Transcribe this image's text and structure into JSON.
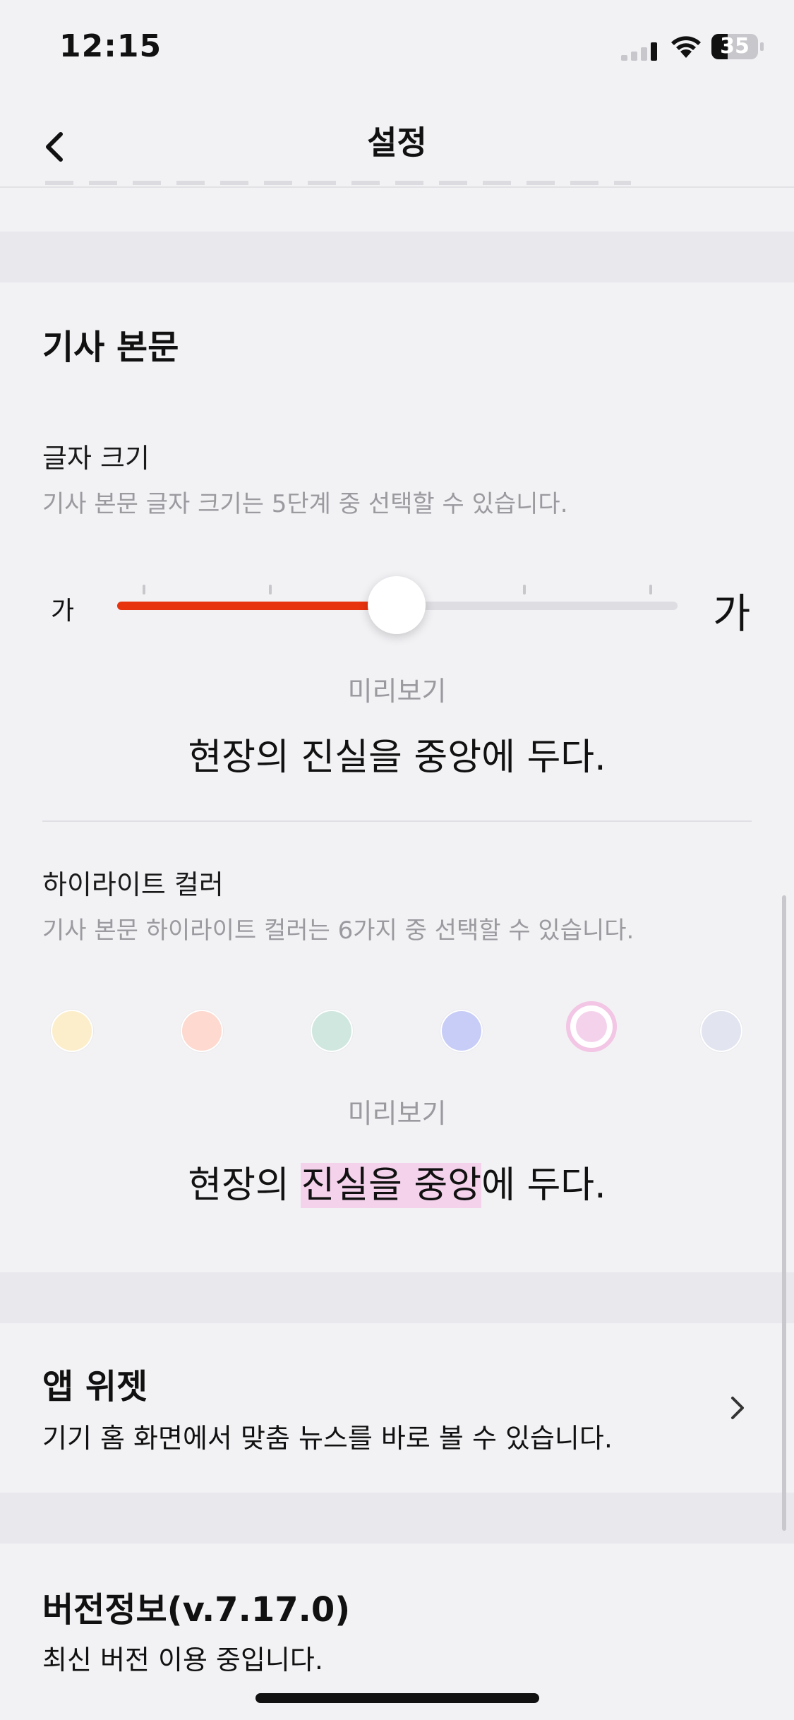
{
  "status": {
    "time": "12:15",
    "battery": "35",
    "battery_level": 0.35
  },
  "header": {
    "title": "설정"
  },
  "article": {
    "section_title": "기사 본문",
    "font_size": {
      "label": "글자 크기",
      "description": "기사 본문 글자 크기는 5단계 중 선택할 수 있습니다.",
      "small_glyph": "가",
      "large_glyph": "가",
      "level": 3,
      "levels": 5,
      "preview_label": "미리보기",
      "preview_text": "현장의 진실을 중앙에 두다."
    },
    "highlight": {
      "label": "하이라이트 컬러",
      "description": "기사 본문 하이라이트 컬러는 6가지 중 선택할 수 있습니다.",
      "colors": [
        "#fdeecb",
        "#fdd9cf",
        "#d0e7e0",
        "#c8cdf7",
        "#f5d2ec",
        "#e2e5f0"
      ],
      "selected_index": 4,
      "preview_label": "미리보기",
      "preview_before": "현장의 ",
      "preview_highlight": "진실을 중앙",
      "preview_after": "에 두다."
    }
  },
  "widget": {
    "title": "앱 위젯",
    "description": "기기 홈 화면에서 맞춤 뉴스를 바로 볼 수 있습니다."
  },
  "version": {
    "title": "버전정보(v.7.17.0)",
    "description": "최신 버전 이용 중입니다."
  },
  "colors": {
    "accent": "#e8330f",
    "background": "#f2f2f5",
    "separator": "#e8e8ed"
  }
}
